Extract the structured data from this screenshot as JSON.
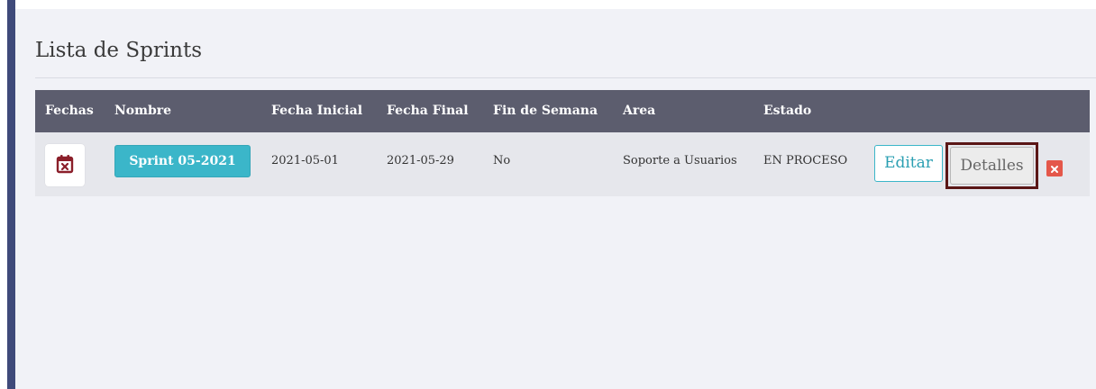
{
  "panel": {
    "title": "Lista de Sprints"
  },
  "table": {
    "headers": [
      "Fechas",
      "Nombre",
      "Fecha Inicial",
      "Fecha Final",
      "Fin de Semana",
      "Area",
      "Estado"
    ],
    "rows": [
      {
        "fechas_icon": "calendar-x-icon",
        "nombre": "Sprint 05-2021",
        "fecha_inicial": "2021-05-01",
        "fecha_final": "2021-05-29",
        "fin_de_semana": "No",
        "area": "Soporte a Usuarios",
        "estado": "EN PROCESO",
        "actions": {
          "edit_label": "Editar",
          "details_label": "Detalles",
          "delete_icon": "close-icon"
        }
      }
    ]
  },
  "colors": {
    "sidebar_accent": "#3f4a7a",
    "header_bg": "#5c5d6e",
    "sprint_button": "#3bb6c9",
    "delete_button": "#e4574a",
    "highlight_outline": "#5a1616",
    "calendar_icon": "#8b1f2a"
  }
}
